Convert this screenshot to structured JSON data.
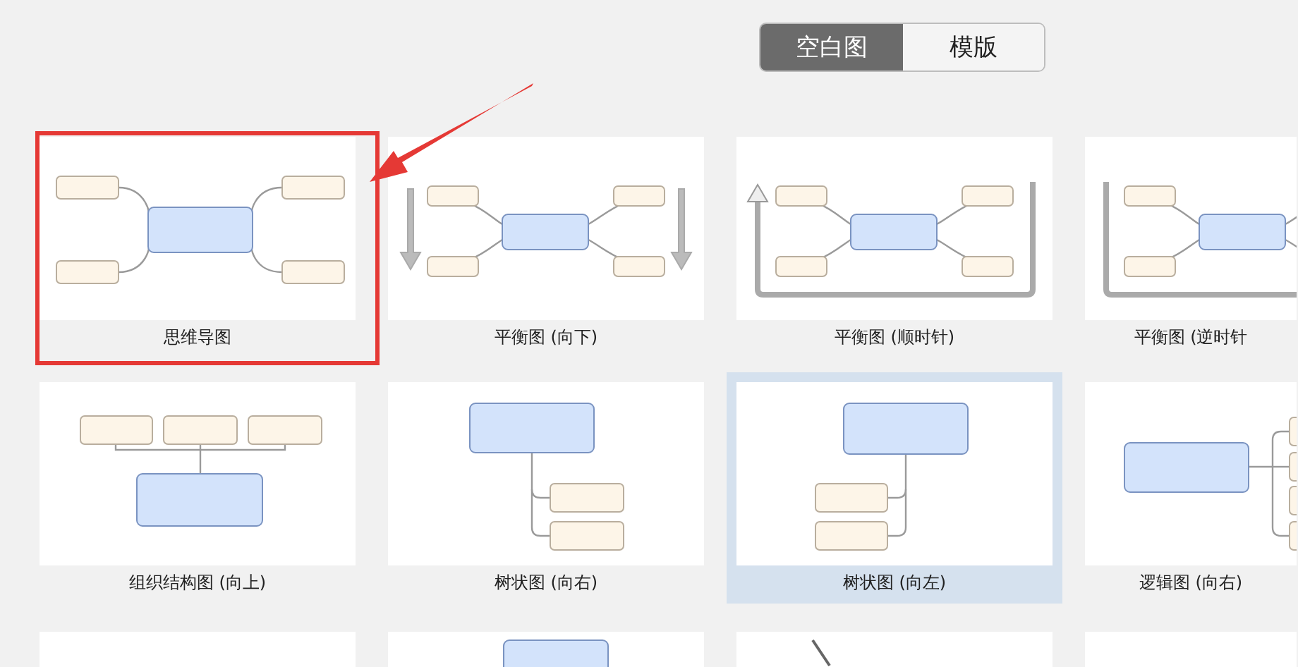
{
  "tabs": [
    {
      "label": "空白图",
      "selected": true
    },
    {
      "label": "模版",
      "selected": false
    }
  ],
  "templates": [
    {
      "kind": "mindmap",
      "label": "思维导图",
      "selected": false,
      "marked": true
    },
    {
      "kind": "balance-down",
      "label": "平衡图 (向下)",
      "selected": false,
      "marked": false
    },
    {
      "kind": "balance-cw",
      "label": "平衡图 (顺时针)",
      "selected": false,
      "marked": false
    },
    {
      "kind": "balance-ccw",
      "label": "平衡图 (逆时针",
      "selected": false,
      "marked": false
    },
    {
      "kind": "org-up",
      "label": "组织结构图 (向上)",
      "selected": false,
      "marked": false
    },
    {
      "kind": "tree-right",
      "label": "树状图 (向右)",
      "selected": false,
      "marked": false
    },
    {
      "kind": "tree-left",
      "label": "树状图 (向左)",
      "selected": true,
      "marked": false
    },
    {
      "kind": "logic-right",
      "label": "逻辑图 (向右)",
      "selected": false,
      "marked": false
    },
    {
      "kind": "blank",
      "selected": false,
      "marked": false
    },
    {
      "kind": "top-node",
      "selected": false,
      "marked": false
    },
    {
      "kind": "slant-line",
      "selected": false,
      "marked": false
    },
    {
      "kind": "blank",
      "selected": false,
      "marked": false
    }
  ]
}
